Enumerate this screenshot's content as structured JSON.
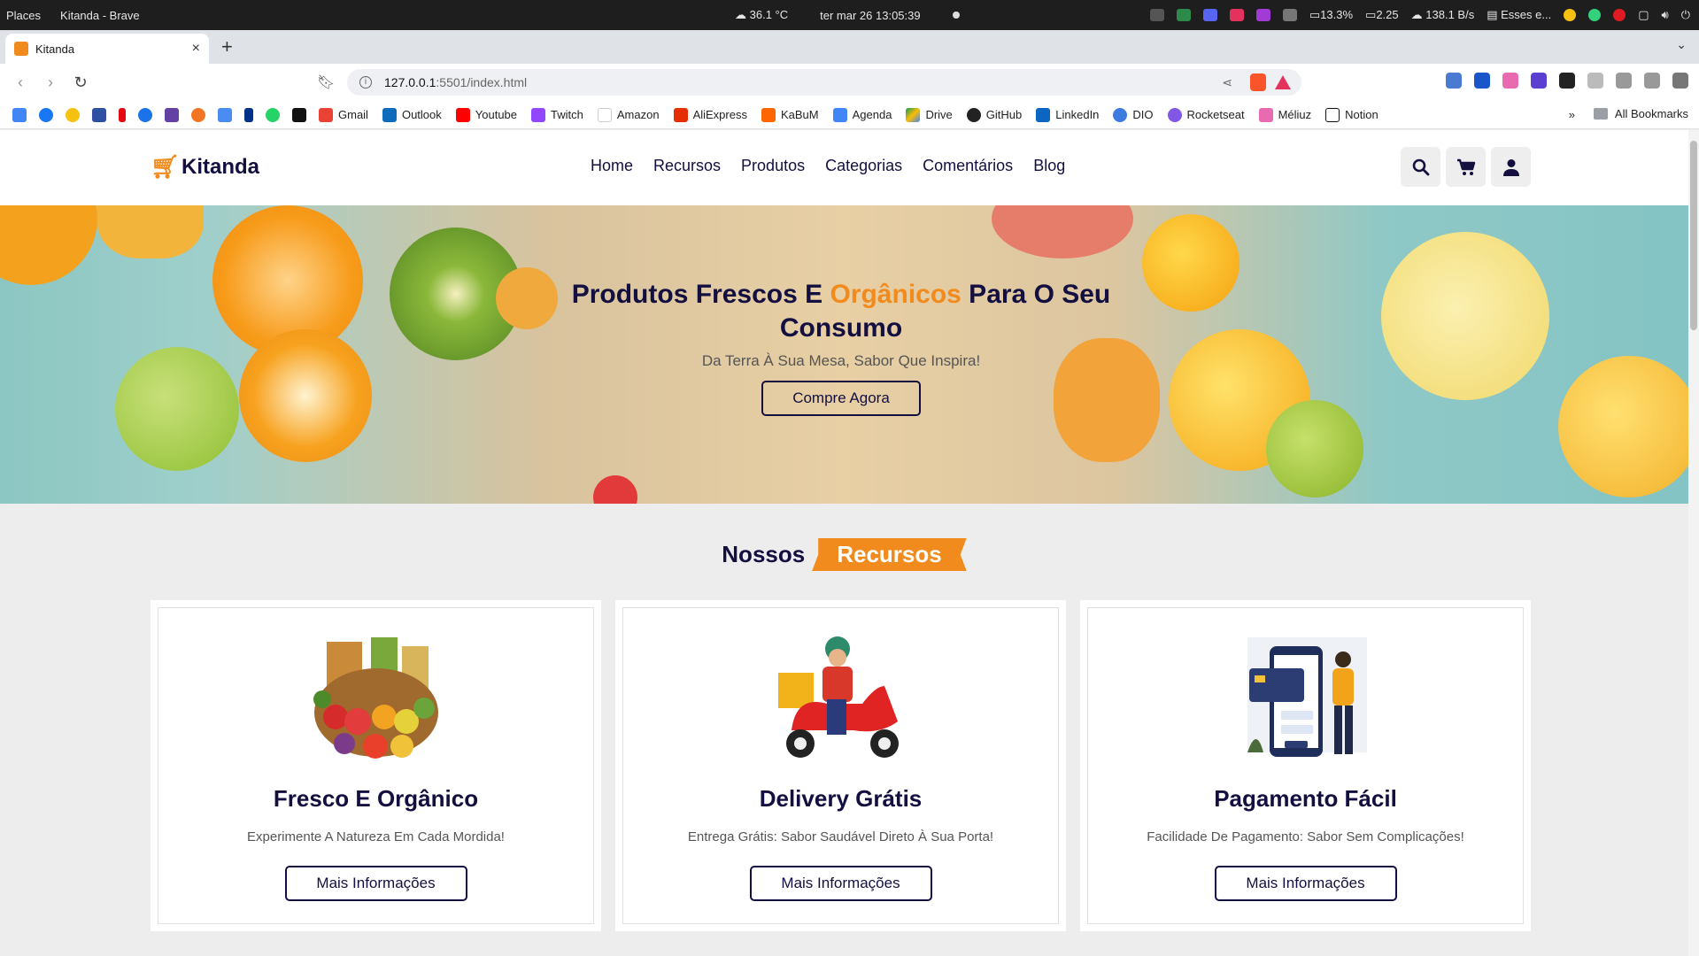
{
  "os_bar": {
    "places": "Places",
    "window_title": "Kitanda - Brave",
    "weather": "36.1 °C",
    "datetime": "ter mar 26  13:05:39",
    "cpu": "13.3%",
    "load": "2.25",
    "net": "138.1 B/s",
    "notes": "Esses e..."
  },
  "browser": {
    "tab_title": "Kitanda",
    "url_host": "127.0.0.1",
    "url_path": ":5501/index.html"
  },
  "bookmarks": [
    "Gmail",
    "Outlook",
    "Youtube",
    "Twitch",
    "Amazon",
    "AliExpress",
    "KaBuM",
    "Agenda",
    "Drive",
    "GitHub",
    "LinkedIn",
    "DIO",
    "Rocketseat",
    "Méliuz",
    "Notion"
  ],
  "bookmarks_more": "»",
  "bookmarks_all": "All Bookmarks",
  "site": {
    "logo": "Kitanda",
    "nav": [
      "Home",
      "Recursos",
      "Produtos",
      "Categorias",
      "Comentários",
      "Blog"
    ]
  },
  "hero": {
    "title_1": "Produtos Frescos E ",
    "title_accent": "Orgânicos",
    "title_2": " Para O Seu Consumo",
    "subtitle": "Da Terra À Sua Mesa, Sabor Que Inspira!",
    "cta": "Compre Agora"
  },
  "features": {
    "heading_1": "Nossos",
    "heading_2": "Recursos",
    "cards": [
      {
        "title": "Fresco E Orgânico",
        "desc": "Experimente A Natureza Em Cada Mordida!",
        "button": "Mais Informações"
      },
      {
        "title": "Delivery Grátis",
        "desc": "Entrega Grátis: Sabor Saudável Direto À Sua Porta!",
        "button": "Mais Informações"
      },
      {
        "title": "Pagamento Fácil",
        "desc": "Facilidade De Pagamento: Sabor Sem Complicações!",
        "button": "Mais Informações"
      }
    ]
  },
  "colors": {
    "brand_dark": "#130f40",
    "accent": "#f28b1d"
  }
}
